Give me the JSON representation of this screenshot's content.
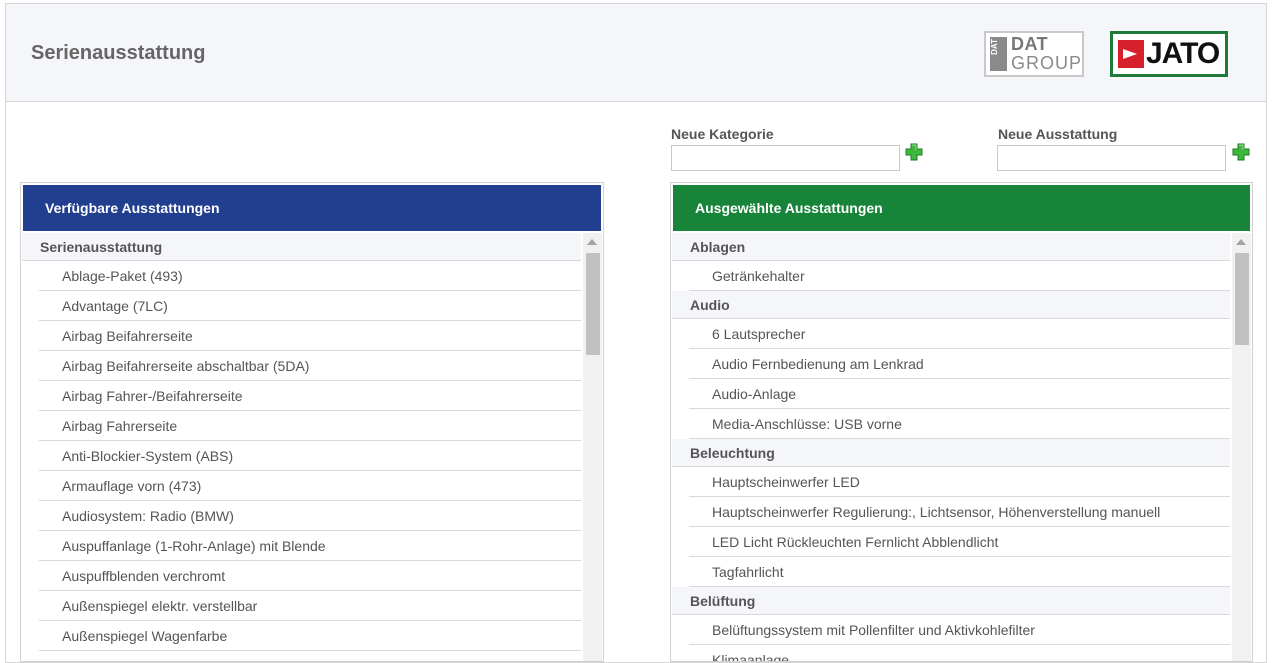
{
  "header": {
    "title": "Serienausstattung",
    "logo_dat": {
      "mark": "DAT",
      "line1": "DAT",
      "line2": "GROUP"
    },
    "logo_jato": {
      "text": "JATO",
      "border_color": "#1e7a3a",
      "mark_color": "#d6202c"
    }
  },
  "form": {
    "new_category_label": "Neue Kategorie",
    "new_category_value": "",
    "new_equipment_label": "Neue Ausstattung",
    "new_equipment_value": "",
    "add_icon": "plus-icon",
    "add_icon_color": "#3db83d"
  },
  "available": {
    "title": "Verfügbare Ausstattungen",
    "header_color": "#223e8f",
    "category": "Serienausstattung",
    "items": [
      "Ablage-Paket (493)",
      "Advantage (7LC)",
      "Airbag Beifahrerseite",
      "Airbag Beifahrerseite abschaltbar (5DA)",
      "Airbag Fahrer-/Beifahrerseite",
      "Airbag Fahrerseite",
      "Anti-Blockier-System (ABS)",
      "Armauflage vorn (473)",
      "Audiosystem: Radio (BMW)",
      "Auspuffanlage (1-Rohr-Anlage) mit Blende",
      "Auspuffblenden verchromt",
      "Außenspiegel elektr. verstellbar",
      "Außenspiegel Wagenfarbe"
    ]
  },
  "selected": {
    "title": "Ausgewählte Ausstattungen",
    "header_color": "#17843a",
    "groups": [
      {
        "category": "Ablagen",
        "items": [
          "Getränkehalter"
        ]
      },
      {
        "category": "Audio",
        "items": [
          "6 Lautsprecher",
          "Audio Fernbedienung am Lenkrad",
          "Audio-Anlage",
          "Media-Anschlüsse: USB vorne"
        ]
      },
      {
        "category": "Beleuchtung",
        "items": [
          "Hauptscheinwerfer LED",
          "Hauptscheinwerfer Regulierung:, Lichtsensor, Höhenverstellung manuell",
          "LED Licht Rückleuchten Fernlicht Abblendlicht",
          "Tagfahrlicht"
        ]
      },
      {
        "category": "Belüftung",
        "items": [
          "Belüftungssystem mit Pollenfilter und Aktivkohlefilter",
          "Klimaanlage"
        ]
      }
    ]
  }
}
